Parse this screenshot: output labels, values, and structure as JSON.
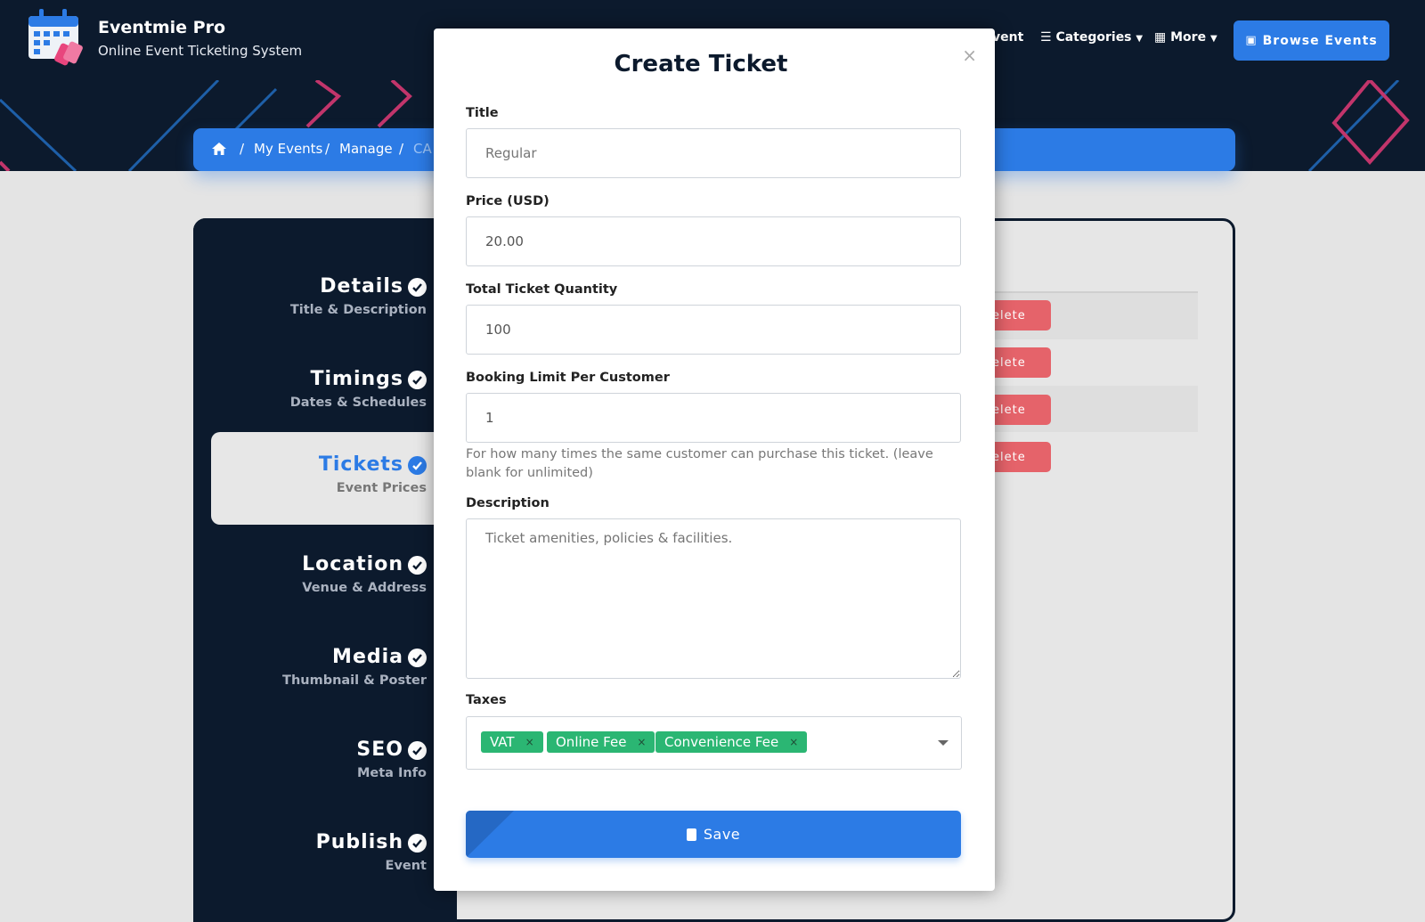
{
  "header": {
    "brand_title": "Eventmie Pro",
    "brand_subtitle": "Online Event Ticketing System",
    "nav_partial": "vent",
    "nav_categories": "Categories",
    "nav_more": "More",
    "browse_button": "Browse Events"
  },
  "breadcrumb": {
    "items": [
      "My Events",
      "Manage",
      "CA"
    ],
    "separator": "/"
  },
  "sidebar": {
    "steps": [
      {
        "title": "Details",
        "subtitle": "Title & Description"
      },
      {
        "title": "Timings",
        "subtitle": "Dates & Schedules"
      },
      {
        "title": "Tickets",
        "subtitle": "Event Prices"
      },
      {
        "title": "Location",
        "subtitle": "Venue & Address"
      },
      {
        "title": "Media",
        "subtitle": "Thumbnail & Poster"
      },
      {
        "title": "SEO",
        "subtitle": "Meta Info"
      },
      {
        "title": "Publish",
        "subtitle": "Event"
      }
    ],
    "active_step": "Tickets"
  },
  "table": {
    "delete_label": "elete"
  },
  "modal": {
    "title": "Create Ticket",
    "close_symbol": "×",
    "title_label": "Title",
    "title_placeholder": "Regular",
    "price_label": "Price (USD)",
    "price_value": "20.00",
    "quantity_label": "Total Ticket Quantity",
    "quantity_value": "100",
    "limit_label": "Booking Limit Per Customer",
    "limit_value": "1",
    "limit_help": "For how many times the same customer can purchase this ticket. (leave blank for unlimited)",
    "description_label": "Description",
    "description_placeholder": "Ticket amenities, policies & facilities.",
    "taxes_label": "Taxes",
    "taxes": [
      "VAT",
      "Online Fee",
      "Convenience Fee"
    ],
    "tag_remove": "×",
    "save_label": "Save"
  },
  "colors": {
    "navy": "#0c1a2d",
    "primary": "#2c7be5",
    "tag_green": "#2bb673",
    "danger": "#e5636a"
  }
}
